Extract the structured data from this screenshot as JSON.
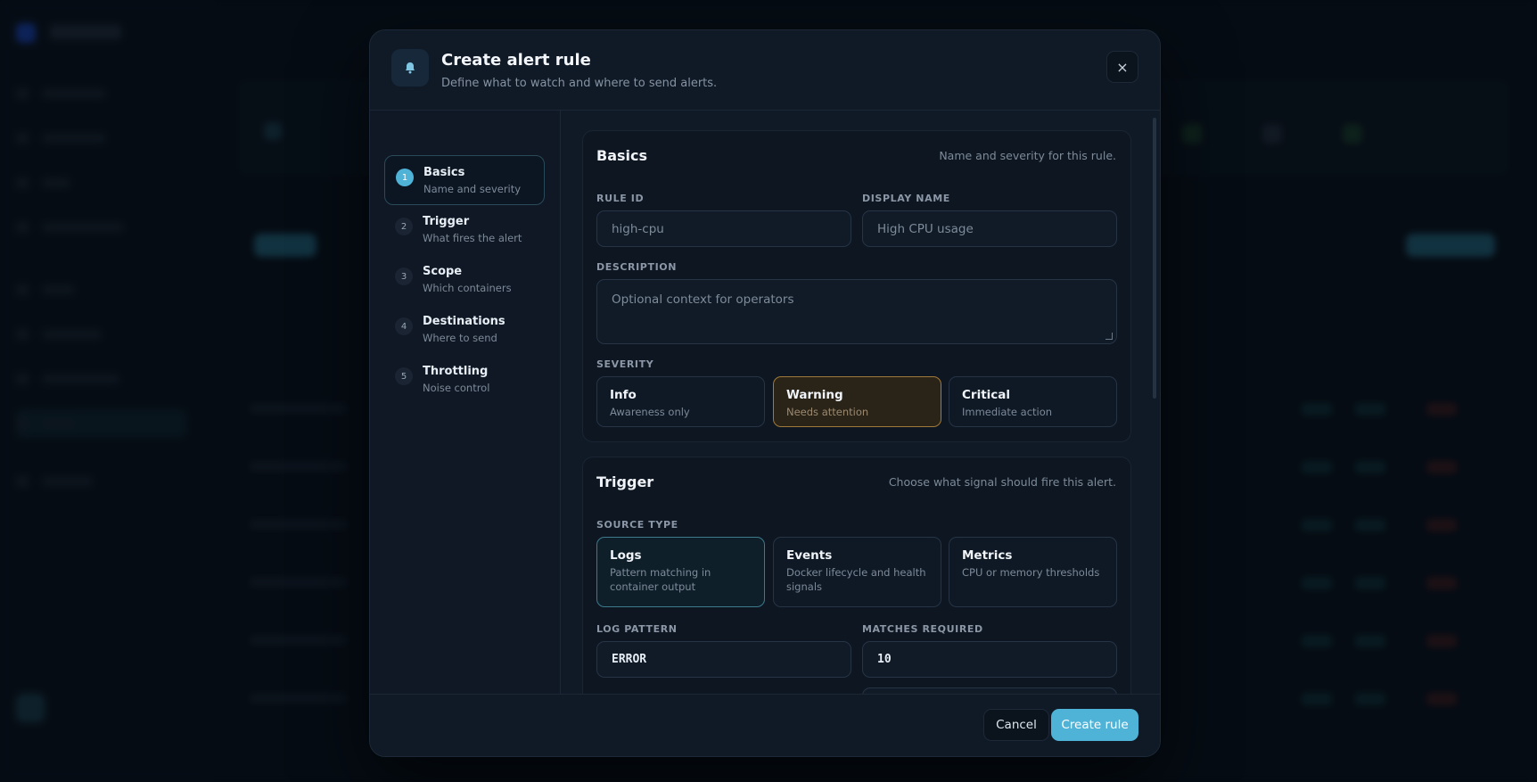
{
  "modal": {
    "title": "Create alert rule",
    "subtitle": "Define what to watch and where to send alerts.",
    "header_icon": "bell-icon",
    "close_icon": "close-icon",
    "close_glyph": "×"
  },
  "steps": [
    {
      "num": "1",
      "title": "Basics",
      "sub": "Name and severity",
      "active": true
    },
    {
      "num": "2",
      "title": "Trigger",
      "sub": "What fires the alert",
      "active": false
    },
    {
      "num": "3",
      "title": "Scope",
      "sub": "Which containers",
      "active": false
    },
    {
      "num": "4",
      "title": "Destinations",
      "sub": "Where to send",
      "active": false
    },
    {
      "num": "5",
      "title": "Throttling",
      "sub": "Noise control",
      "active": false
    }
  ],
  "basics": {
    "title": "Basics",
    "hint": "Name and severity for this rule.",
    "rule_id_label": "RULE ID",
    "rule_id_placeholder": "high-cpu",
    "display_name_label": "DISPLAY NAME",
    "display_name_placeholder": "High CPU usage",
    "description_label": "DESCRIPTION",
    "description_placeholder": "Optional context for operators",
    "severity_label": "SEVERITY",
    "severity_options": [
      {
        "title": "Info",
        "sub": "Awareness only"
      },
      {
        "title": "Warning",
        "sub": "Needs attention"
      },
      {
        "title": "Critical",
        "sub": "Immediate action"
      }
    ],
    "selected_severity": "Warning"
  },
  "trigger": {
    "title": "Trigger",
    "hint": "Choose what signal should fire this alert.",
    "source_type_label": "SOURCE TYPE",
    "source_options": [
      {
        "title": "Logs",
        "sub": "Pattern matching in container output"
      },
      {
        "title": "Events",
        "sub": "Docker lifecycle and health signals"
      },
      {
        "title": "Metrics",
        "sub": "CPU or memory thresholds"
      }
    ],
    "selected_source": "Logs",
    "log_pattern_label": "LOG PATTERN",
    "log_pattern_value": "ERROR",
    "matches_required_label": "MATCHES REQUIRED",
    "matches_required_value": "10"
  },
  "footer": {
    "cancel_label": "Cancel",
    "create_label": "Create rule"
  },
  "colors": {
    "accent": "#4fb3d8",
    "warning_border": "#a07a3a",
    "modal_bg": "#101a26"
  }
}
